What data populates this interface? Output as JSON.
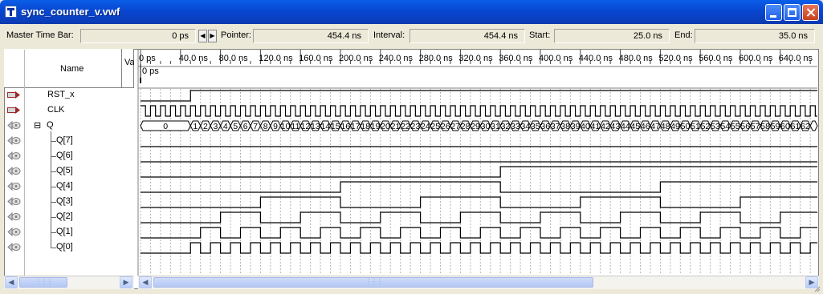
{
  "window": {
    "title": "sync_counter_v.vwf"
  },
  "infobar": {
    "master_label": "Master Time Bar:",
    "master_value": "0 ps",
    "pointer_label": "Pointer:",
    "pointer_value": "454.4 ns",
    "interval_label": "Interval:",
    "interval_value": "454.4 ns",
    "start_label": "Start:",
    "start_value": "25.0 ns",
    "end_label": "End:",
    "end_value": "35.0 ns"
  },
  "header": {
    "name": "Name",
    "value": "Va",
    "cursor_label": "0 ps"
  },
  "timeline": {
    "ticks": [
      "0 ps",
      "40.0 ns",
      "80.0 ns",
      "120.0 ns",
      "160.0 ns",
      "200.0 ns",
      "240.0 ns",
      "280.0 ns",
      "320.0 ns",
      "360.0 ns",
      "400.0 ns",
      "440.0 ns",
      "480.0 ns",
      "520.0 ns",
      "560.0 ns",
      "600.0 ns",
      "640.0 ns"
    ],
    "start_ns": 0,
    "ns_per_tick": 40,
    "clock_period_ns": 10,
    "reset_release_ns": 50
  },
  "signals": [
    {
      "name": "RST_x",
      "kind": "input"
    },
    {
      "name": "CLK",
      "kind": "input"
    },
    {
      "name": "Q",
      "kind": "output",
      "group": true,
      "expander": "⊟"
    },
    {
      "name": "Q[7]",
      "kind": "output"
    },
    {
      "name": "Q[6]",
      "kind": "output"
    },
    {
      "name": "Q[5]",
      "kind": "output"
    },
    {
      "name": "Q[4]",
      "kind": "output"
    },
    {
      "name": "Q[3]",
      "kind": "output"
    },
    {
      "name": "Q[2]",
      "kind": "output"
    },
    {
      "name": "Q[1]",
      "kind": "output"
    },
    {
      "name": "Q[0]",
      "kind": "output"
    }
  ],
  "colors": {
    "waveform": "#000000",
    "grid": "#b4b4b4",
    "input_icon": "#9a2a2a",
    "output_icon": "#808080"
  }
}
